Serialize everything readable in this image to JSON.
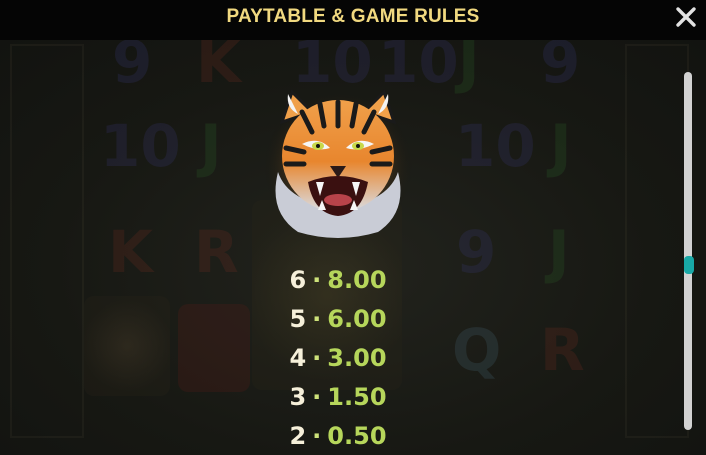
{
  "header": {
    "title": "PAYTABLE & GAME RULES",
    "close_icon": "close-icon"
  },
  "symbol": {
    "icon": "tiger-symbol"
  },
  "paytable": [
    {
      "count": "6",
      "value": "8.00"
    },
    {
      "count": "5",
      "value": "6.00"
    },
    {
      "count": "4",
      "value": "3.00"
    },
    {
      "count": "3",
      "value": "1.50"
    },
    {
      "count": "2",
      "value": "0.50"
    }
  ],
  "scroll": {
    "position": 0.5
  },
  "colors": {
    "title": "#f1d980",
    "value": "#b6d65b",
    "count": "#f6f0da",
    "scroll_thumb": "#18a8a6"
  }
}
